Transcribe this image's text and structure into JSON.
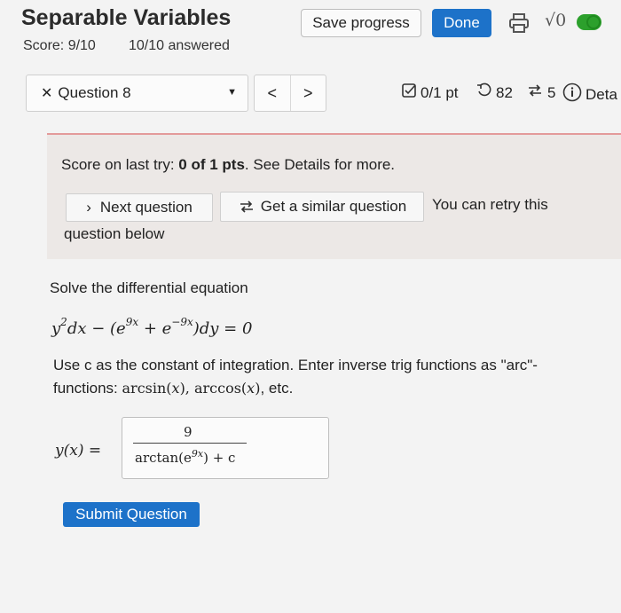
{
  "header": {
    "title": "Separable Variables",
    "score": "Score: 9/10",
    "answered": "10/10 answered",
    "save_label": "Save progress",
    "done_label": "Done",
    "icons": [
      "print-icon",
      "sqrt-icon",
      "toggle-switch"
    ],
    "sqrt_text": "√0"
  },
  "nav": {
    "question_label": "Question 8",
    "prev": "<",
    "next": ">",
    "points": "0/1 pt",
    "retries": "82",
    "similar_count": "5",
    "details": "Deta"
  },
  "feedback": {
    "last_try_prefix": "Score on last try: ",
    "last_try_score": "0 of 1 pts",
    "last_try_suffix": ". See Details for more.",
    "next_question": "Next question",
    "similar_question": "Get a similar question",
    "retry_line1": "You can retry this",
    "retry_line2": "question below"
  },
  "question": {
    "prompt": "Solve the differential equation",
    "instruction_part1": "Use c as the constant of integration. Enter inverse trig functions as \"arc\"-",
    "instruction_part2": "functions: "
  },
  "answer": {
    "label": "y(x) =",
    "numerator": "9",
    "denominator_prefix": "arctan(e",
    "denominator_exp": "9x",
    "denominator_suffix": ") + c"
  },
  "submit_label": "Submit Question",
  "colors": {
    "primary_blue": "#1d72c9",
    "panel_bg": "#ece8e6",
    "panel_border": "#e39a9a",
    "toggle_green": "#2ca02c"
  }
}
